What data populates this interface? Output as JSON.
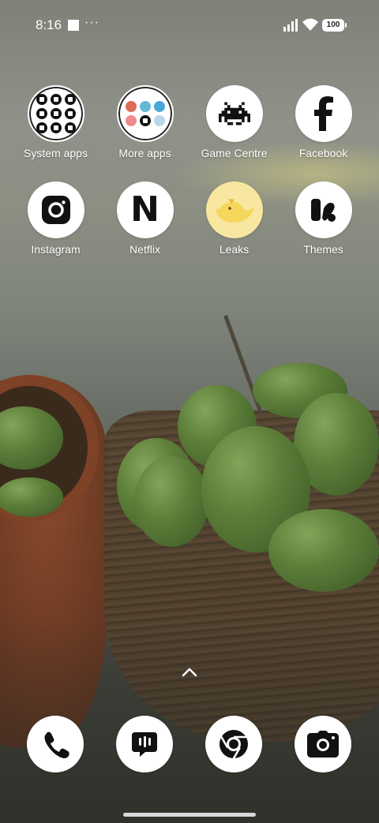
{
  "status_bar": {
    "time": "8:16",
    "dots": "···",
    "battery": "100"
  },
  "home_screen": {
    "apps": [
      {
        "label": "System apps",
        "icon": "folder-icon"
      },
      {
        "label": "More apps",
        "icon": "folder-icon"
      },
      {
        "label": "Game Centre",
        "icon": "space-invader-icon"
      },
      {
        "label": "Facebook",
        "icon": "facebook-icon"
      },
      {
        "label": "Instagram",
        "icon": "instagram-icon"
      },
      {
        "label": "Netflix",
        "icon": "netflix-icon"
      },
      {
        "label": "Leaks",
        "icon": "chick-icon"
      },
      {
        "label": "Themes",
        "icon": "themes-icon"
      }
    ],
    "netflix_letter": "N",
    "facebook_letter": "f"
  },
  "dock": {
    "apps": [
      "phone-icon",
      "messages-icon",
      "chrome-icon",
      "camera-icon"
    ]
  },
  "colors": {
    "icon_background": "#ffffff",
    "label_text": "#ffffff",
    "leaks_yellow": "#f5d75c"
  }
}
